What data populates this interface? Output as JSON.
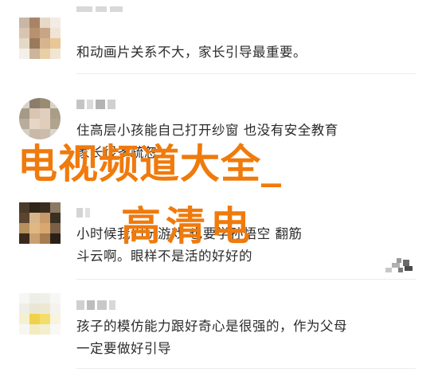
{
  "overlay": {
    "title": "电视频道大全_",
    "subtitle": "高清电"
  },
  "comments": [
    {
      "text": "和动画片关系不大，家长引导最重要。"
    },
    {
      "text_line1": "住高层小孩能自己打开纱窗 也没有安全教育",
      "text_line2": "家长很多疏忽"
    },
    {
      "text_line1": "小时候我们玩游戏 也要学孙悟空  翻筋",
      "text_line2": "斗云啊。眼样不是活的好好的"
    },
    {
      "text_line1": "孩子的模仿能力跟好奇心是很强的，作为父母",
      "text_line2": "一定要做好引导"
    }
  ]
}
